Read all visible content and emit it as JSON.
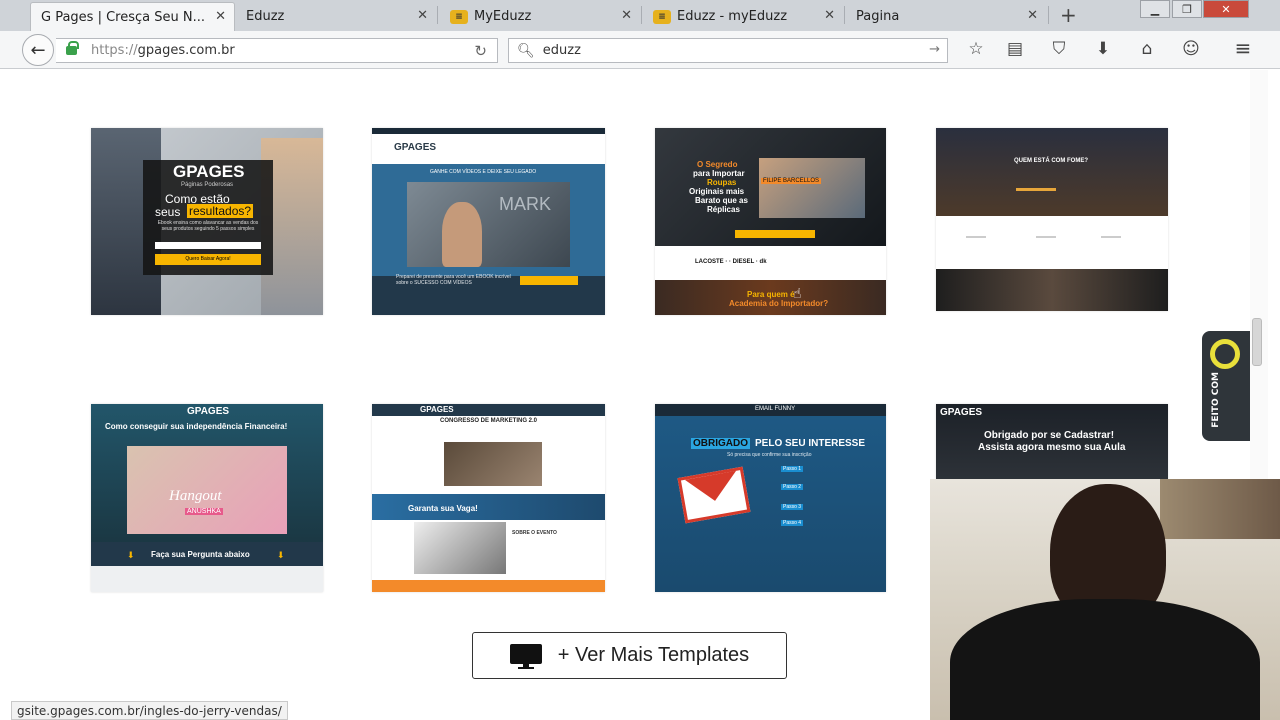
{
  "browser": {
    "tabs": [
      {
        "label": "G Pages | Cresça Seu N...",
        "active": true,
        "favicon": ""
      },
      {
        "label": "Eduzz",
        "active": false,
        "favicon": ""
      },
      {
        "label": "MyEduzz",
        "active": false,
        "favicon": "eduzz-logo"
      },
      {
        "label": "Eduzz - myEduzz",
        "active": false,
        "favicon": "eduzz-logo"
      },
      {
        "label": "Pagina",
        "active": false,
        "favicon": ""
      }
    ],
    "url_proto": "https://",
    "url_host": "gpages.com.br",
    "search_value": "eduzz",
    "status_url": "gsite.gpages.com.br/ingles-do-jerry-vendas/",
    "toolbar_icons": [
      "star-icon",
      "reading-list-icon",
      "pocket-icon",
      "download-icon",
      "home-icon",
      "chat-icon",
      "menu-icon"
    ]
  },
  "templates": {
    "t1": {
      "brand": "GPAGES",
      "tag": "Páginas Poderosas",
      "line1": "Como estão",
      "line2a": "seus",
      "line2b": "resultados?",
      "sub": "Ebook ensina como alavancar as vendas dos seus produtos seguindo 5 passos simples",
      "cta": "Quero Baixar Agora!"
    },
    "t2": {
      "brand": "GPAGES",
      "headline": "GANHE COM VÍDEOS E DEIXE SEU LEGADO",
      "video_text": "MARK",
      "footer": "Preparei de presente para você um EBOOK incrível sobre o SUCESSO COM VÍDEOS"
    },
    "t3": {
      "line1": "O Segredo",
      "line2": "para Importar",
      "line3": "Roupas",
      "line4": "Originais mais",
      "line5": "Barato que as",
      "line6": "Réplicas",
      "badge": "FILIPE BARCELLOS",
      "brands": "LACOSTE   ·   ·   DIESEL   ·   dk",
      "bottom1": "Para quem é",
      "bottom2": "Academia do Importador?"
    },
    "t4": {
      "title": "QUEM ESTÁ COM FOME?"
    },
    "t5": {
      "brand": "GPAGES",
      "headline": "Como conseguir sua independência Financeira!",
      "script": "Hangout",
      "name": "ANUSHKA",
      "bottom": "Faça sua Pergunta abaixo"
    },
    "t6": {
      "brand": "GPAGES",
      "title": "CONGRESSO DE MARKETING 2.0",
      "cta": "Garanta sua Vaga!",
      "about": "SOBRE O EVENTO"
    },
    "t7": {
      "logo": "EMAIL FUNNY",
      "title1": "OBRIGADO",
      "title2": "PELO SEU INTERESSE",
      "subtitle": "Só precisa que confirme sua inscrição",
      "steps": [
        "Passo 1",
        "Passo 2",
        "Passo 3",
        "Passo 4"
      ]
    },
    "t8": {
      "brand": "GPAGES",
      "line1": "Obrigado por se Cadastrar!",
      "line2": "Assista agora mesmo sua Aula"
    }
  },
  "more_button": "+ Ver Mais Templates",
  "badge_label": "FEITO COM",
  "colors": {
    "gpages_yellow": "#f7b500",
    "tab_strip": "#cfd3d8",
    "chrome": "#f5f6f7"
  }
}
